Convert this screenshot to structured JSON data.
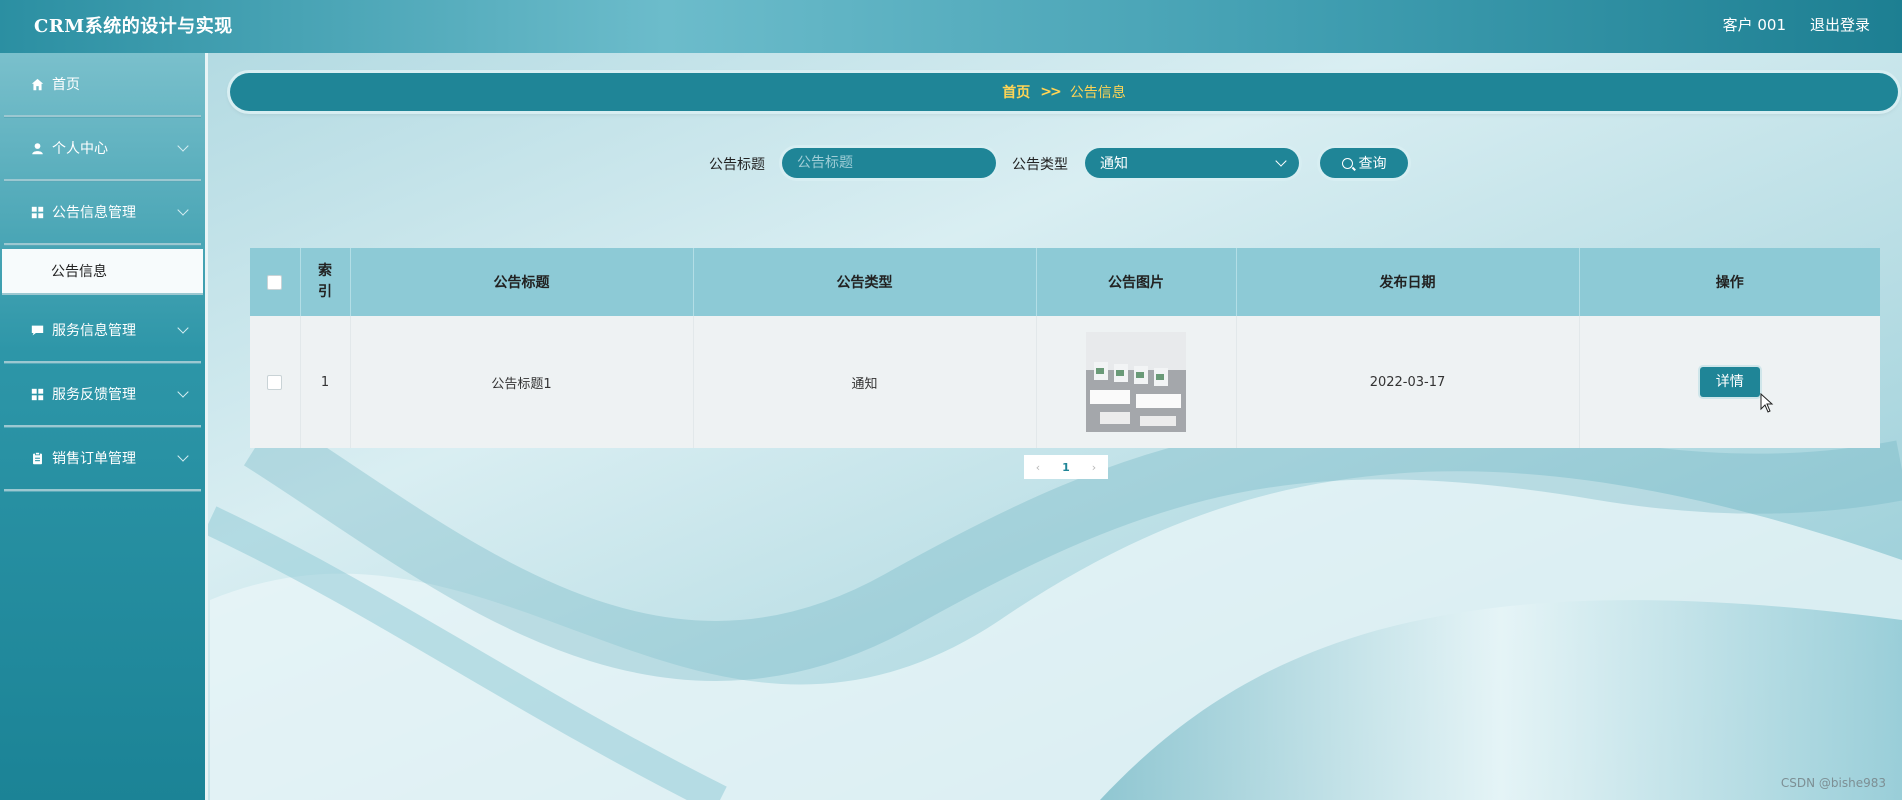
{
  "header": {
    "app_title": "CRM系统的设计与实现",
    "user_label": "客户 001",
    "logout_label": "退出登录"
  },
  "sidebar": {
    "items": [
      {
        "label": "首页",
        "icon": "home-icon",
        "has_chevron": false
      },
      {
        "label": "个人中心",
        "icon": "user-icon",
        "has_chevron": true
      },
      {
        "label": "公告信息管理",
        "icon": "grid-icon",
        "has_chevron": true,
        "expanded": true,
        "children": [
          {
            "label": "公告信息",
            "active": true
          }
        ]
      },
      {
        "label": "服务信息管理",
        "icon": "chat-icon",
        "has_chevron": true
      },
      {
        "label": "服务反馈管理",
        "icon": "grid-icon",
        "has_chevron": true
      },
      {
        "label": "销售订单管理",
        "icon": "clipboard-icon",
        "has_chevron": true
      }
    ]
  },
  "breadcrumb": {
    "home": "首页",
    "separator": ">>",
    "current": "公告信息"
  },
  "search": {
    "title_label": "公告标题",
    "title_placeholder": "公告标题",
    "title_value": "",
    "type_label": "公告类型",
    "type_value": "通知",
    "query_button": "查询"
  },
  "table": {
    "columns": [
      "",
      "索引",
      "公告标题",
      "公告类型",
      "公告图片",
      "发布日期",
      "操作"
    ],
    "rows": [
      {
        "index": "1",
        "title": "公告标题1",
        "type": "通知",
        "image": "office-photo",
        "date": "2022-03-17",
        "action": "详情"
      }
    ]
  },
  "pagination": {
    "current_page": "1"
  },
  "watermark": "CSDN @bishe983",
  "colors": {
    "primary": "#1f8597",
    "header_bg": "#8dcad6",
    "accent_yellow": "#ffd455"
  }
}
